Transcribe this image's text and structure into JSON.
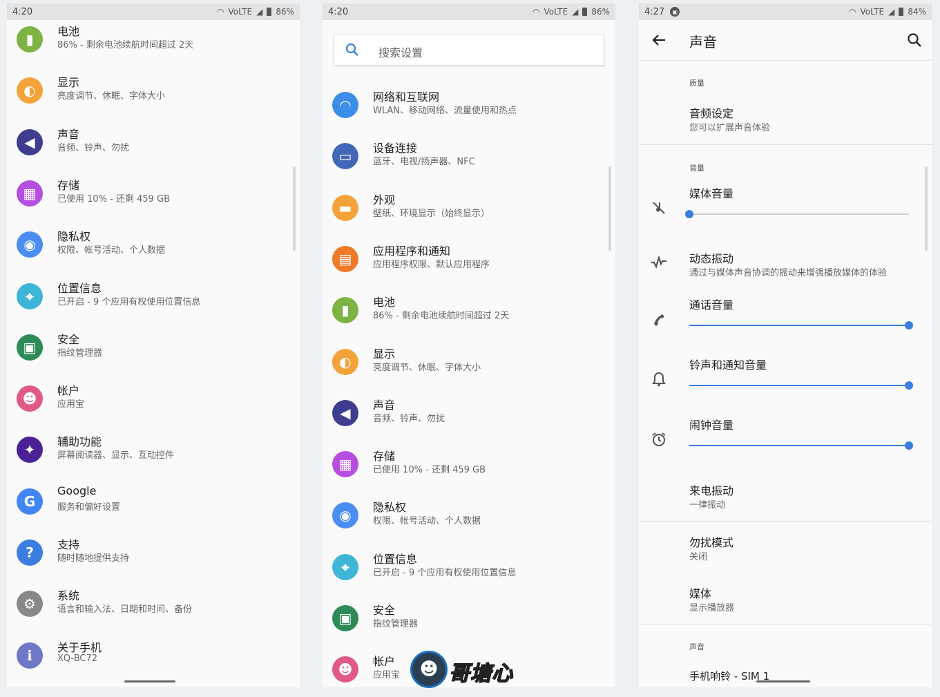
{
  "phone1": {
    "status": {
      "time": "4:20",
      "battery": "86%",
      "network": "VoLTE"
    },
    "items": [
      {
        "title": "电池",
        "sub": "86% - 剩余电池续航时间超过 2天",
        "icon": "battery-icon",
        "color": "#7cb342"
      },
      {
        "title": "显示",
        "sub": "亮度调节、休眠、字体大小",
        "icon": "brightness-icon",
        "color": "#f4a33a"
      },
      {
        "title": "声音",
        "sub": "音频、铃声、勿扰",
        "icon": "volume-icon",
        "color": "#3f3d8f"
      },
      {
        "title": "存储",
        "sub": "已使用 10% - 还剩 459 GB",
        "icon": "storage-icon",
        "color": "#b64fe0"
      },
      {
        "title": "隐私权",
        "sub": "权限、帐号活动、个人数据",
        "icon": "privacy-eye-icon",
        "color": "#4b8df0"
      },
      {
        "title": "位置信息",
        "sub": "已开启 - 9 个应用有权使用位置信息",
        "icon": "location-pin-icon",
        "color": "#3fb6d8"
      },
      {
        "title": "安全",
        "sub": "指纹管理器",
        "icon": "lock-icon",
        "color": "#2e8b57"
      },
      {
        "title": "帐户",
        "sub": "应用宝",
        "icon": "account-icon",
        "color": "#e05a85"
      },
      {
        "title": "辅助功能",
        "sub": "屏幕阅读器、显示、互动控件",
        "icon": "accessibility-icon",
        "color": "#4a2296"
      },
      {
        "title": "Google",
        "sub": "服务和偏好设置",
        "icon": "google-icon",
        "color": "#4285f4"
      },
      {
        "title": "支持",
        "sub": "随时随地提供支持",
        "icon": "help-icon",
        "color": "#3b7ee0"
      },
      {
        "title": "系统",
        "sub": "语言和输入法、日期和时间、备份",
        "icon": "system-gears-icon",
        "color": "#888888"
      },
      {
        "title": "关于手机",
        "sub": "XQ-BC72",
        "icon": "phone-info-icon",
        "color": "#6f77c9"
      }
    ]
  },
  "phone2": {
    "status": {
      "time": "4:20",
      "battery": "86%",
      "network": "VoLTE"
    },
    "search_placeholder": "搜索设置",
    "items": [
      {
        "title": "网络和互联网",
        "sub": "WLAN、移动网络、流量使用和热点",
        "icon": "wifi-icon",
        "color": "#3b8fe8"
      },
      {
        "title": "设备连接",
        "sub": "蓝牙、电视/扬声器、NFC",
        "icon": "devices-icon",
        "color": "#4468b8"
      },
      {
        "title": "外观",
        "sub": "壁纸、环境显示（始终显示）",
        "icon": "appearance-icon",
        "color": "#f4a33a"
      },
      {
        "title": "应用程序和通知",
        "sub": "应用程序权限、默认应用程序",
        "icon": "apps-icon",
        "color": "#f07a2a"
      },
      {
        "title": "电池",
        "sub": "86% - 剩余电池续航时间超过 2天",
        "icon": "battery-icon",
        "color": "#7cb342"
      },
      {
        "title": "显示",
        "sub": "亮度调节、休眠、字体大小",
        "icon": "brightness-icon",
        "color": "#f4a33a"
      },
      {
        "title": "声音",
        "sub": "音频、铃声、勿扰",
        "icon": "volume-icon",
        "color": "#3f3d8f"
      },
      {
        "title": "存储",
        "sub": "已使用 10% - 还剩 459 GB",
        "icon": "storage-icon",
        "color": "#b64fe0"
      },
      {
        "title": "隐私权",
        "sub": "权限、帐号活动、个人数据",
        "icon": "privacy-eye-icon",
        "color": "#4b8df0"
      },
      {
        "title": "位置信息",
        "sub": "已开启 - 9 个应用有权使用位置信息",
        "icon": "location-pin-icon",
        "color": "#3fb6d8"
      },
      {
        "title": "安全",
        "sub": "指纹管理器",
        "icon": "lock-icon",
        "color": "#2e8b57"
      },
      {
        "title": "帐户",
        "sub": "应用宝",
        "icon": "account-icon",
        "color": "#e05a85"
      }
    ]
  },
  "phone3": {
    "status": {
      "time": "4:27",
      "battery": "84%",
      "network": "VoLTE"
    },
    "title": "声音",
    "quality_header": "质量",
    "audio_settings": {
      "title": "音频设定",
      "sub": "您可以扩展声音体验"
    },
    "volume_header": "音量",
    "media_volume": {
      "title": "媒体音量",
      "level": 0.0
    },
    "dynamic_vibration": {
      "title": "动态振动",
      "sub": "通过与媒体声音协调的振动来增强播放媒体的体验"
    },
    "call_volume": {
      "title": "通话音量",
      "level": 1.0
    },
    "ring_volume": {
      "title": "铃声和通知音量",
      "level": 1.0
    },
    "alarm_volume": {
      "title": "闹钟音量",
      "level": 1.0
    },
    "vibrate_on_ring": {
      "title": "来电振动",
      "sub": "一律振动"
    },
    "dnd": {
      "title": "勿扰模式",
      "sub": "关闭"
    },
    "media": {
      "title": "媒体",
      "sub": "显示播放器"
    },
    "sound_header": "声音",
    "ringtone": {
      "title": "手机响铃 - SIM 1"
    }
  },
  "watermark": {
    "text": "哥塘心"
  },
  "accent": "#3b7ee0"
}
